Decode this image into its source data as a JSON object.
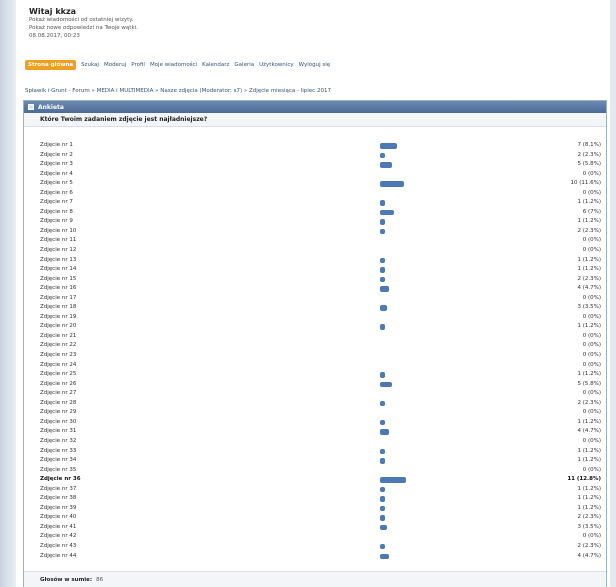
{
  "header": {
    "welcome": "Witaj kkza",
    "line1": "Pokaż wiadomości od ostatniej wizyty.",
    "line2": "Pokaż nowe odpowiedzi na Twoje wątki.",
    "line3": "08.08.2017, 00:23"
  },
  "nav": [
    "Strona główna",
    "Szukaj",
    "Moderuj",
    "Profil",
    "Moje wiadomości",
    "Kalendarz",
    "Galeria",
    "Użytkownicy",
    "Wyloguj się"
  ],
  "breadcrumb": "Spławik i Grunt - Forum » MEDIA i MULTIMEDIA » Nasze zdjęcia (Moderator: s7) » Zdjęcie miesiąca - lipiec 2017",
  "panel_title": "Ankieta",
  "question": "Które Twoim zadaniem zdjęcie jest najładniejsze?",
  "colors": {
    "accent": "#f0a020",
    "bar": "#4f79b3",
    "panel_header": "#5a78a5"
  },
  "options": [
    {
      "label": "Zdjęcie nr 1",
      "result": "7 (8.1%)",
      "votes": 7
    },
    {
      "label": "Zdjęcie nr 2",
      "result": "2 (2.3%)",
      "votes": 2
    },
    {
      "label": "Zdjęcie nr 3",
      "result": "5 (5.8%)",
      "votes": 5
    },
    {
      "label": "Zdjęcie nr 4",
      "result": "0 (0%)",
      "votes": 0
    },
    {
      "label": "Zdjęcie nr 5",
      "result": "10 (11.6%)",
      "votes": 10
    },
    {
      "label": "Zdjęcie nr 6",
      "result": "0 (0%)",
      "votes": 0
    },
    {
      "label": "Zdjęcie nr 7",
      "result": "1 (1.2%)",
      "votes": 1
    },
    {
      "label": "Zdjęcie nr 8",
      "result": "6 (7%)",
      "votes": 6
    },
    {
      "label": "Zdjęcie nr 9",
      "result": "1 (1.2%)",
      "votes": 1
    },
    {
      "label": "Zdjęcie nr 10",
      "result": "2 (2.3%)",
      "votes": 2
    },
    {
      "label": "Zdjęcie nr 11",
      "result": "0 (0%)",
      "votes": 0
    },
    {
      "label": "Zdjęcie nr 12",
      "result": "0 (0%)",
      "votes": 0
    },
    {
      "label": "Zdjęcie nr 13",
      "result": "1 (1.2%)",
      "votes": 1
    },
    {
      "label": "Zdjęcie nr 14",
      "result": "1 (1.2%)",
      "votes": 1
    },
    {
      "label": "Zdjęcie nr 15",
      "result": "2 (2.3%)",
      "votes": 2
    },
    {
      "label": "Zdjęcie nr 16",
      "result": "4 (4.7%)",
      "votes": 4
    },
    {
      "label": "Zdjęcie nr 17",
      "result": "0 (0%)",
      "votes": 0
    },
    {
      "label": "Zdjęcie nr 18",
      "result": "3 (3.5%)",
      "votes": 3
    },
    {
      "label": "Zdjęcie nr 19",
      "result": "0 (0%)",
      "votes": 0
    },
    {
      "label": "Zdjęcie nr 20",
      "result": "1 (1.2%)",
      "votes": 1
    },
    {
      "label": "Zdjęcie nr 21",
      "result": "0 (0%)",
      "votes": 0
    },
    {
      "label": "Zdjęcie nr 22",
      "result": "0 (0%)",
      "votes": 0
    },
    {
      "label": "Zdjęcie nr 23",
      "result": "0 (0%)",
      "votes": 0
    },
    {
      "label": "Zdjęcie nr 24",
      "result": "0 (0%)",
      "votes": 0
    },
    {
      "label": "Zdjęcie nr 25",
      "result": "1 (1.2%)",
      "votes": 1
    },
    {
      "label": "Zdjęcie nr 26",
      "result": "5 (5.8%)",
      "votes": 5
    },
    {
      "label": "Zdjęcie nr 27",
      "result": "0 (0%)",
      "votes": 0
    },
    {
      "label": "Zdjęcie nr 28",
      "result": "2 (2.3%)",
      "votes": 2
    },
    {
      "label": "Zdjęcie nr 29",
      "result": "0 (0%)",
      "votes": 0
    },
    {
      "label": "Zdjęcie nr 30",
      "result": "1 (1.2%)",
      "votes": 1
    },
    {
      "label": "Zdjęcie nr 31",
      "result": "4 (4.7%)",
      "votes": 4
    },
    {
      "label": "Zdjęcie nr 32",
      "result": "0 (0%)",
      "votes": 0
    },
    {
      "label": "Zdjęcie nr 33",
      "result": "1 (1.2%)",
      "votes": 1
    },
    {
      "label": "Zdjęcie nr 34",
      "result": "1 (1.2%)",
      "votes": 1
    },
    {
      "label": "Zdjęcie nr 35",
      "result": "0 (0%)",
      "votes": 0
    },
    {
      "label": "Zdjęcie nr 36",
      "result": "11 (12.8%)",
      "votes": 11,
      "winner": true
    },
    {
      "label": "Zdjęcie nr 37",
      "result": "1 (1.2%)",
      "votes": 1
    },
    {
      "label": "Zdjęcie nr 38",
      "result": "1 (1.2%)",
      "votes": 1
    },
    {
      "label": "Zdjęcie nr 39",
      "result": "1 (1.2%)",
      "votes": 1
    },
    {
      "label": "Zdjęcie nr 40",
      "result": "2 (2.3%)",
      "votes": 2
    },
    {
      "label": "Zdjęcie nr 41",
      "result": "3 (3.5%)",
      "votes": 3
    },
    {
      "label": "Zdjęcie nr 42",
      "result": "0 (0%)",
      "votes": 0
    },
    {
      "label": "Zdjęcie nr 43",
      "result": "2 (2.3%)",
      "votes": 2
    },
    {
      "label": "Zdjęcie nr 44",
      "result": "4 (4.7%)",
      "votes": 4
    }
  ],
  "total_label": "Głosów w sumie:",
  "total_value": "86"
}
